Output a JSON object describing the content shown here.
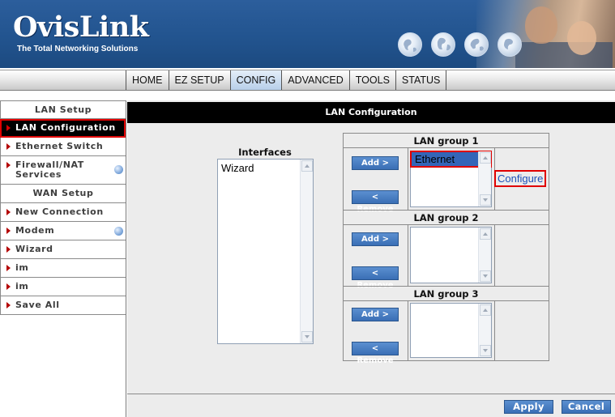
{
  "header": {
    "logo": "OvisLink",
    "tagline": "The Total Networking Solutions"
  },
  "nav": {
    "tabs": [
      "HOME",
      "EZ SETUP",
      "CONFIG",
      "ADVANCED",
      "TOOLS",
      "STATUS"
    ],
    "active": "CONFIG"
  },
  "sidebar": {
    "lan_header": "LAN Setup",
    "lan_items": [
      "LAN Configuration",
      "Ethernet Switch",
      "Firewall/NAT Services"
    ],
    "wan_header": "WAN Setup",
    "wan_items": [
      "New Connection",
      "Modem",
      "Wizard",
      "im",
      "im",
      "Save All"
    ],
    "selected": "LAN Configuration"
  },
  "main": {
    "title": "LAN Configuration",
    "interfaces_label": "Interfaces",
    "interfaces": [
      "Wizard"
    ],
    "groups": [
      {
        "title": "LAN group 1",
        "members": [
          "Ethernet"
        ]
      },
      {
        "title": "LAN group 2",
        "members": []
      },
      {
        "title": "LAN group 3",
        "members": []
      }
    ],
    "add_label": "Add >",
    "remove_label": "< Remove",
    "configure_label": "Configure",
    "apply_label": "Apply",
    "cancel_label": "Cancel"
  },
  "colors": {
    "header_blue": "#22548f",
    "button_blue": "#3a6fb5",
    "highlight_red": "#e00000",
    "link_blue": "#1c50b8"
  }
}
